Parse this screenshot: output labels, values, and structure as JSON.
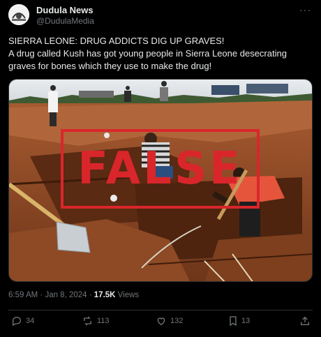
{
  "author": {
    "name": "Dudula News",
    "handle": "@DudulaMedia"
  },
  "post": {
    "headline": "SIERRA LEONE: DRUG ADDICTS DIG UP GRAVES!",
    "text": "A drug called Kush has got young people in Sierra Leone desecrating graves for bones which they use to make the drug!"
  },
  "media": {
    "stamp": "FALSE",
    "stamp_color": "#d9262b"
  },
  "meta": {
    "time": "6:59 AM",
    "date": "Jan 8, 2024",
    "views_count": "17.5K",
    "views_label": "Views"
  },
  "actions": {
    "replies": "34",
    "reposts": "113",
    "likes": "132",
    "bookmarks": "13"
  },
  "icons": [
    "more-icon",
    "reply-icon",
    "repost-icon",
    "like-icon",
    "bookmark-icon",
    "share-icon"
  ]
}
